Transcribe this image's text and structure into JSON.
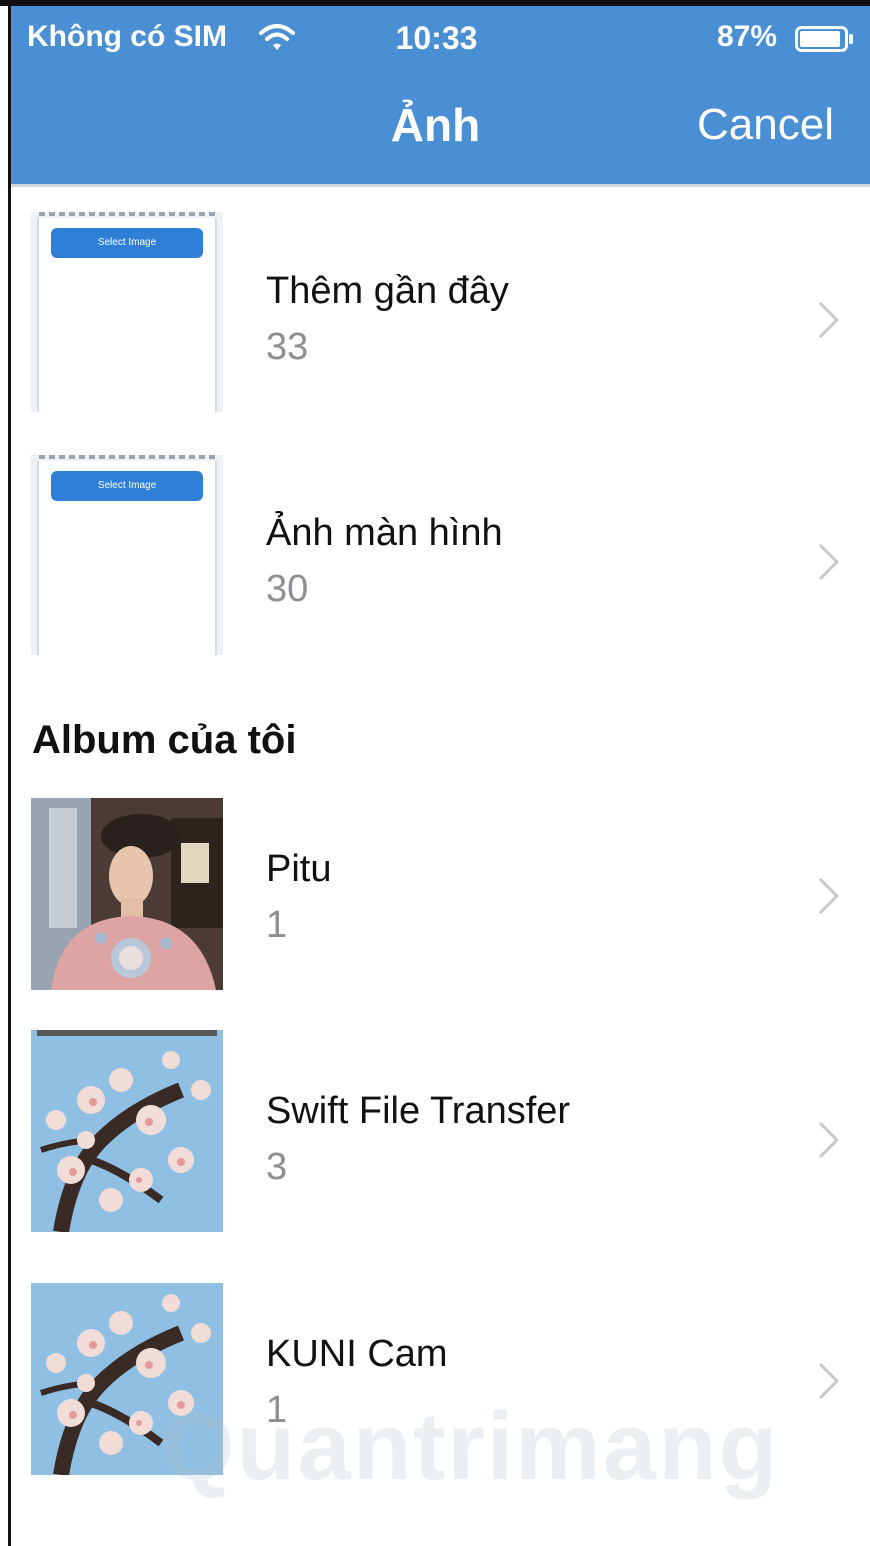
{
  "status_bar": {
    "carrier": "Không có SIM",
    "time": "10:33",
    "battery": "87%"
  },
  "nav": {
    "title": "Ảnh",
    "cancel": "Cancel"
  },
  "albums_top": [
    {
      "title": "Thêm gần đây",
      "count": "33",
      "thumb_button": "Select Image"
    },
    {
      "title": "Ảnh màn hình",
      "count": "30",
      "thumb_button": "Select Image"
    }
  ],
  "my_albums": {
    "section_title": "Album của tôi",
    "items": [
      {
        "title": "Pitu",
        "count": "1"
      },
      {
        "title": "Swift File Transfer",
        "count": "3"
      },
      {
        "title": "KUNI Cam",
        "count": "1"
      }
    ]
  },
  "watermark": "Quantrimang",
  "colors": {
    "header_bg": "#4a8ed3",
    "count_gray": "#8e8e93",
    "chevron_gray": "#c7c7cc"
  }
}
